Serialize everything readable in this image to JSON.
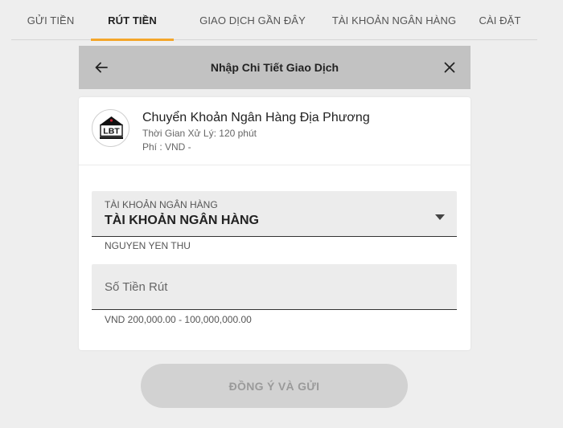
{
  "tabs": [
    {
      "label": "GỬI TIỀN",
      "active": false
    },
    {
      "label": "RÚT TIỀN",
      "active": true
    },
    {
      "label": "GIAO DỊCH GẦN ĐÂY",
      "active": false
    },
    {
      "label": "TÀI KHOẢN NGÂN HÀNG",
      "active": false
    },
    {
      "label": "CÀI ĐẶT",
      "active": false
    }
  ],
  "modal": {
    "title": "Nhập Chi Tiết Giao Dịch",
    "back_icon": "arrow-left-icon",
    "close_icon": "close-icon"
  },
  "method": {
    "logo_text": "LBT",
    "name": "Chuyển Khoản Ngân Hàng Địa Phương",
    "processing_time": "Thời Gian Xử Lý: 120 phút",
    "fee": "Phí : VND -"
  },
  "bank_field": {
    "label": "TÀI KHOẢN NGÂN HÀNG",
    "value": "TÀI KHOẢN NGÂN HÀNG",
    "account_holder": "NGUYEN YEN THU"
  },
  "amount_field": {
    "placeholder": "Số Tiền Rút",
    "value": "",
    "range": "VND 200,000.00 - 100,000,000.00"
  },
  "submit": {
    "label": "ĐỒNG Ý VÀ GỬI",
    "enabled": false
  },
  "colors": {
    "accent": "#f4a62a",
    "header_bg": "#c2c2c2",
    "page_bg": "#eeeeee",
    "logo_red": "#c8202f"
  }
}
